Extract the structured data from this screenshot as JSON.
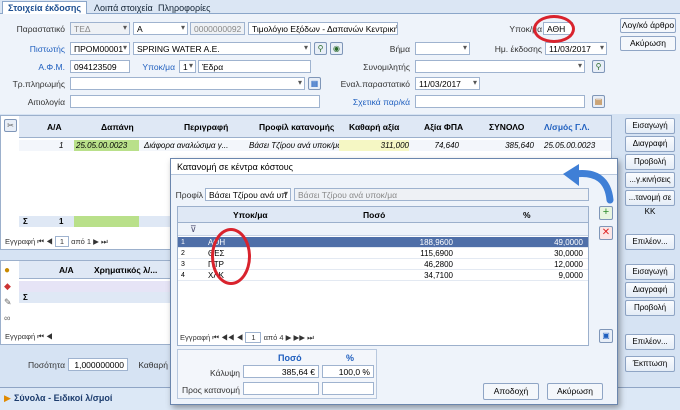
{
  "tabs": [
    "Στοιχεία έκδοσης",
    "Λοιπά στοιχεία",
    "Πληροφορίες"
  ],
  "form": {
    "parastatiko_label": "Παραστατικό",
    "parastatiko_code": "ΤΕΔ",
    "parastatiko_series": "Α",
    "parastatiko_number": "0000000092",
    "parastatiko_desc": "Τιμολόγιο Εξόδων - Δαπανών Κεντρικής ES",
    "ypokma_label": "Υποκ/μα",
    "ypokma_value": "ΑΘΗ",
    "pistotis_label": "Πιστωτής",
    "pistotis_code": "ΠΡΟΜ00001",
    "pistotis_name": "SPRING WATER A.E.",
    "vima_label": "Βήμα",
    "hm_ekdosis_label": "Ημ. έκδοσης",
    "hm_ekdosis_value": "11/03/2017",
    "afm_label": "Α.Φ.Μ.",
    "afm_value": "094123509",
    "ypokma2_label": "Υποκ/μα",
    "ypokma2_num": "1",
    "ypokma2_value": "Έδρα",
    "synomilitis_label": "Συνομιλητής",
    "troplirom_label": "Τρ.πληρωμής",
    "enal_label": "Εναλ.παραστατικό",
    "enal_date": "11/03/2017",
    "aitiologia_label": "Αιτιολογία",
    "sxetika_label": "Σχετικά παρ/κά"
  },
  "right_buttons": {
    "logko": "Λογ/κό άρθρο",
    "akyrosi": "Ακύρωση"
  },
  "main_grid": {
    "headers": [
      "Α/Α",
      "Δαπάνη",
      "Περιγραφή",
      "Προφίλ κατανομής",
      "Καθαρή αξία",
      "Αξία ΦΠΑ",
      "ΣΥΝΟΛΟ",
      "Λ/σμός Γ.Λ."
    ],
    "row": [
      "1",
      "25.05.00.0023",
      "Διάφορα αναλώσιμα γ...",
      "Βάσει Τζίρου ανά υποκ/μα",
      "311,000",
      "74,640",
      "385,640",
      "25.05.00.0023"
    ],
    "sum_row": "1",
    "nav_text": "Εγγραφή",
    "nav_of": "από 1"
  },
  "side_buttons": {
    "eisagogi": "Εισαγωγή",
    "diagrafi": "Διαγραφή",
    "provoli": "Προβολή",
    "kinisis": "...γ.κινήσεις",
    "katanomi_kk": "...τανομή σε ΚΚ",
    "epilogh": "Επιλέον...",
    "eisagogi2": "Εισαγωγή",
    "diagrafi2": "Διαγραφή",
    "provoli2": "Προβολή",
    "epilogh2": "Επιλέον...",
    "ekptosi": "Έκπτωση"
  },
  "second_grid": {
    "headers": [
      "Α/Α",
      "Χρηματικός λ/..."
    ],
    "nav_text": "Εγγραφή"
  },
  "posotita_label": "Ποσότητα",
  "posotita_value": "1,000000000",
  "kathari_label": "Καθαρή",
  "footer_label": "Σύνολα - Ειδικοί λ/σμοί",
  "dialog": {
    "title": "Κατανομή σε κέντρα κόστους",
    "profil_label": "Προφίλ",
    "profil_value": "Βάσει Τζίρου ανά υπ",
    "profil_desc": "Βάσει Τζίρου ανά υποκ/μα",
    "headers": [
      "Υποκ/μα",
      "Ποσό",
      "%"
    ],
    "rows": [
      {
        "n": "1",
        "ypokma": "ΑΘΗ",
        "poso": "188,9600",
        "pct": "49,0000"
      },
      {
        "n": "2",
        "ypokma": "ΘΕΣ",
        "poso": "115,6900",
        "pct": "30,0000"
      },
      {
        "n": "3",
        "ypokma": "ΠΤΡ",
        "poso": "46,2800",
        "pct": "12,0000"
      },
      {
        "n": "4",
        "ypokma": "ΧΛΚ",
        "poso": "34,7100",
        "pct": "9,0000"
      }
    ],
    "nav_text": "Εγγραφή",
    "nav_current": "1",
    "nav_of": "από 4",
    "summary": {
      "col_poso": "Ποσό",
      "col_pct": "%",
      "kalypsi_label": "Κάλυψη",
      "kalypsi_poso": "385,64 €",
      "kalypsi_pct": "100,0 %",
      "pros_label": "Προς κατανομή"
    },
    "apodoxi": "Αποδοχή",
    "akyrosi": "Ακύρωση"
  },
  "colors": {
    "accent": "#1f5fbf",
    "selected_row": "#4f6fa8",
    "highlight_green": "#b9e08a",
    "circle": "#d9232d",
    "arrow": "#3f7fd6"
  }
}
